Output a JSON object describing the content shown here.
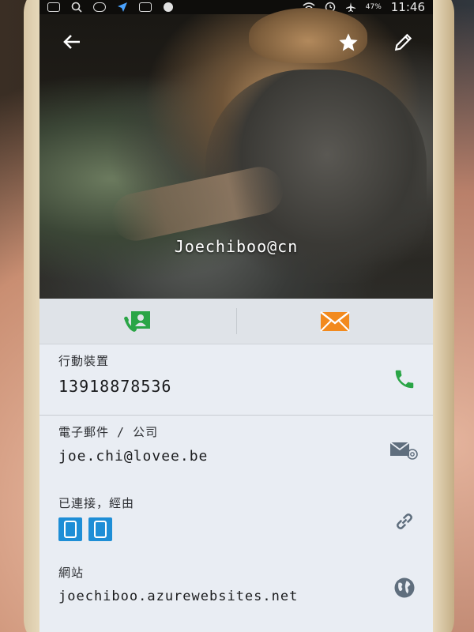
{
  "status_bar": {
    "time": "11:46",
    "left_icons": [
      "sim-icon",
      "search-icon",
      "line-icon",
      "navigation-icon",
      "instagram-icon",
      "notification-icon"
    ],
    "right_icons": [
      "wifi-icon",
      "alarm-icon",
      "airplane-icon"
    ],
    "battery_text": "47%"
  },
  "header": {
    "contact_name": "Joechiboo@cn",
    "back_icon": "back-arrow-icon",
    "favorite_icon": "star-icon",
    "edit_icon": "pencil-icon"
  },
  "actions": [
    {
      "icon": "contact-call-icon",
      "color": "#2aa546"
    },
    {
      "icon": "email-icon",
      "color": "#f28a1e"
    }
  ],
  "details": {
    "phone": {
      "label": "行動裝置",
      "value": "13918878536",
      "action_icon": "phone-icon",
      "action_color": "#2aa546"
    },
    "email": {
      "label": "電子郵件 / 公司",
      "value": "joe.chi@lovee.be",
      "action_icon": "email-at-icon",
      "action_color": "#5f6e7d"
    },
    "linked": {
      "label": "已連接，經由",
      "badges": [
        "device-icon",
        "device-icon"
      ],
      "action_icon": "link-icon",
      "badge_color": "#1e8ed6"
    },
    "website": {
      "label": "網站",
      "value": "joechiboo.azurewebsites.net",
      "action_icon": "globe-icon",
      "action_color": "#5f6e7d"
    }
  }
}
